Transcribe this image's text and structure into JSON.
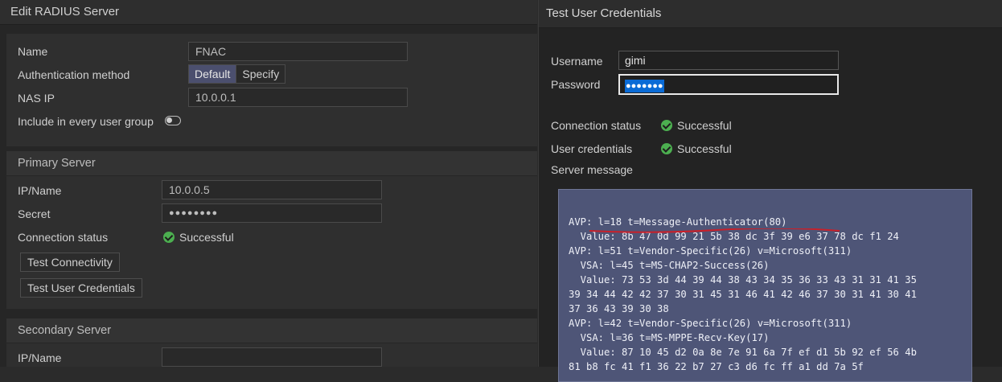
{
  "left": {
    "title": "Edit RADIUS Server",
    "name_label": "Name",
    "name_value": "FNAC",
    "auth_label": "Authentication method",
    "auth_options": [
      "Default",
      "Specify"
    ],
    "auth_selected": "Default",
    "nasip_label": "NAS IP",
    "nasip_value": "10.0.0.1",
    "include_label": "Include in every user group",
    "include_toggle": "off",
    "primary": {
      "header": "Primary Server",
      "ip_label": "IP/Name",
      "ip_value": "10.0.0.5",
      "secret_label": "Secret",
      "secret_value": "●●●●●●●●",
      "status_label": "Connection status",
      "status_value": "Successful",
      "test_connectivity": "Test Connectivity",
      "test_credentials": "Test User Credentials"
    },
    "secondary": {
      "header": "Secondary Server",
      "ip_label": "IP/Name",
      "ip_value": ""
    }
  },
  "right": {
    "title": "Test User Credentials",
    "username_label": "Username",
    "username_value": "gimi",
    "password_label": "Password",
    "password_value": "●●●●●●●",
    "conn_label": "Connection status",
    "conn_value": "Successful",
    "cred_label": "User credentials",
    "cred_value": "Successful",
    "server_msg_label": "Server message",
    "server_msg_lines": [
      "AVP: l=18 t=Message-Authenticator(80)",
      "  Value: 8b 47 0d 99 21 5b 38 dc 3f 39 e6 37 78 dc f1 24",
      "AVP: l=51 t=Vendor-Specific(26) v=Microsoft(311)",
      "  VSA: l=45 t=MS-CHAP2-Success(26)",
      "  Value: 73 53 3d 44 39 44 38 43 34 35 36 33 43 31 31 41 35",
      "39 34 44 42 42 37 30 31 45 31 46 41 42 46 37 30 31 41 30 41",
      "37 36 43 39 30 38",
      "AVP: l=42 t=Vendor-Specific(26) v=Microsoft(311)",
      "  VSA: l=36 t=MS-MPPE-Recv-Key(17)",
      "  Value: 87 10 45 d2 0a 8e 7e 91 6a 7f ef d1 5b 92 ef 56 4b",
      "81 b8 fc 41 f1 36 22 b7 27 c3 d6 fc ff a1 dd 7a 5f"
    ]
  },
  "colors": {
    "accent_selected": "#4b4f6e",
    "success": "#4caf50",
    "message_bg": "#4e5577",
    "annotation_underline": "#c8202a",
    "selection": "#0a6bd6"
  },
  "icons": [
    "check-circle-icon",
    "toggle-switch-icon"
  ]
}
